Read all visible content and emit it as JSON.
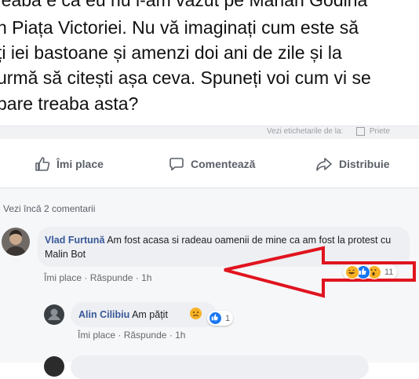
{
  "post": {
    "lines": [
      "reaba e că eu nu l-am văzut pe Marian Godina",
      "n Piața Victoriei. Nu vă imaginați cum este să",
      "ți iei bastoane și amenzi doi ani de zile și la",
      "urmă să citești așa ceva. Spuneți voi cum vi se",
      "pare treaba asta?"
    ]
  },
  "strip": {
    "text_left": "Vezi etichetarile de la:",
    "text_right": "Priete"
  },
  "actions": {
    "like": "Îmi place",
    "comment": "Comentează",
    "share": "Distribuie"
  },
  "comments": {
    "view_more": "Vezi încă 2 comentarii",
    "items": [
      {
        "author": "Vlad Furtună",
        "text": "Am fost acasa si radeau oamenii de mine ca am fost la protest cu Malin Bot",
        "like": "Îmi place",
        "reply": "Răspunde",
        "time": "1h",
        "reaction_count": "11"
      },
      {
        "author": "Alin Cilibiu",
        "text": "Am pățit",
        "like": "Îmi place",
        "reply": "Răspunde",
        "time": "1h",
        "reaction_count": "1"
      }
    ]
  },
  "colors": {
    "name_link": "#385898",
    "annotation_arrow": "#e0141e",
    "like_blue": "#1877f2",
    "haha_yellow": "#f7b125"
  },
  "icons": [
    "thumbs-up-icon",
    "speech-bubble-icon",
    "share-arrow-icon",
    "like-reaction-icon",
    "haha-reaction-icon",
    "wow-reaction-icon",
    "sad-emoji-icon",
    "red-arrow-annotation"
  ]
}
